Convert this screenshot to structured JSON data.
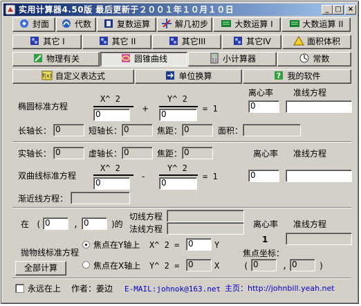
{
  "window": {
    "title": "实用计算器4.50版  最后更新于２００１年１０月１０日",
    "buttons": {
      "minimize": "_",
      "maximize": "□",
      "close": "×"
    }
  },
  "toolbar": {
    "row1": [
      "封面",
      "代数",
      "复数运算",
      "解几初步",
      "大数运算 I",
      "大数运算 II"
    ],
    "row2": [
      "其它 I",
      "其它 II",
      "其它III",
      "其它IV",
      "面积体积"
    ],
    "row3": [
      "物理有关",
      "圆锥曲线",
      "小计算器",
      "常数"
    ],
    "row4": [
      "自定义表达式",
      "单位换算",
      "我的软件"
    ]
  },
  "ellipse": {
    "title": "椭圆标准方程",
    "x2": "X^ 2",
    "y2": "Y^ 2",
    "plus": "+",
    "eq1": "= 1",
    "a_value": "0",
    "b_value": "0",
    "ecc_label": "离心率",
    "ecc_value": "0",
    "dir_label": "准线方程",
    "dir_value": "",
    "long_label": "长轴长：",
    "long_value": "0",
    "short_label": "短轴长：",
    "short_value": "0",
    "focal_label": "焦距：",
    "focal_value": "0",
    "area_label": "面积：",
    "area_value": ""
  },
  "hyperbola": {
    "real_label": "实轴长：",
    "real_value": "0",
    "imag_label": "虚轴长：",
    "imag_value": "0",
    "focal_label": "焦距：",
    "focal_value": "0",
    "ecc_label": "离心率",
    "dir_label": "准线方程",
    "title": "双曲线标准方程",
    "x2": "X^ 2",
    "y2": "Y^ 2",
    "minus": "-",
    "eq1": "= 1",
    "a_value": "0",
    "b_value": "0",
    "ecc_value": "0",
    "dir_value": "",
    "asym_label": "渐近线方程：",
    "asym_value": ""
  },
  "parabola": {
    "at_label": "在",
    "paren_open": "(",
    "x_value": "0",
    "comma": ",",
    "y_value": "0",
    "paren_close": ")的",
    "tangent_label": "切线方程",
    "tangent_value": "",
    "normal_label": "法线方程",
    "normal_value": "",
    "ecc_label": "离心率",
    "dir_label": "准线方程",
    "ecc_value": "1",
    "dir_value": "",
    "title": "抛物线标准方程",
    "option1": "焦点在Y轴上",
    "option1_eq": "X^ 2 =",
    "option1_value": "0",
    "option1_var": "Y",
    "option2": "焦点在X轴上",
    "option2_eq": "Y^ 2 =",
    "option2_value": "0",
    "option2_var": "X",
    "focus_label": "焦点坐标：",
    "focus_open": "(",
    "focus_x": "0",
    "focus_comma": ",",
    "focus_y": "0",
    "focus_close": ")",
    "calc_button": "全部计算"
  },
  "footer": {
    "always_on_top": "永远在上",
    "author": "作者：姜边",
    "email": "E-MAIL:johnok@163.net",
    "homepage": "主页：http://johnbill.yeah.net"
  },
  "colors": {
    "title_start": "#0a246a",
    "title_end": "#a6caf0",
    "face": "#d4d0c8",
    "link": "#0000cc"
  }
}
